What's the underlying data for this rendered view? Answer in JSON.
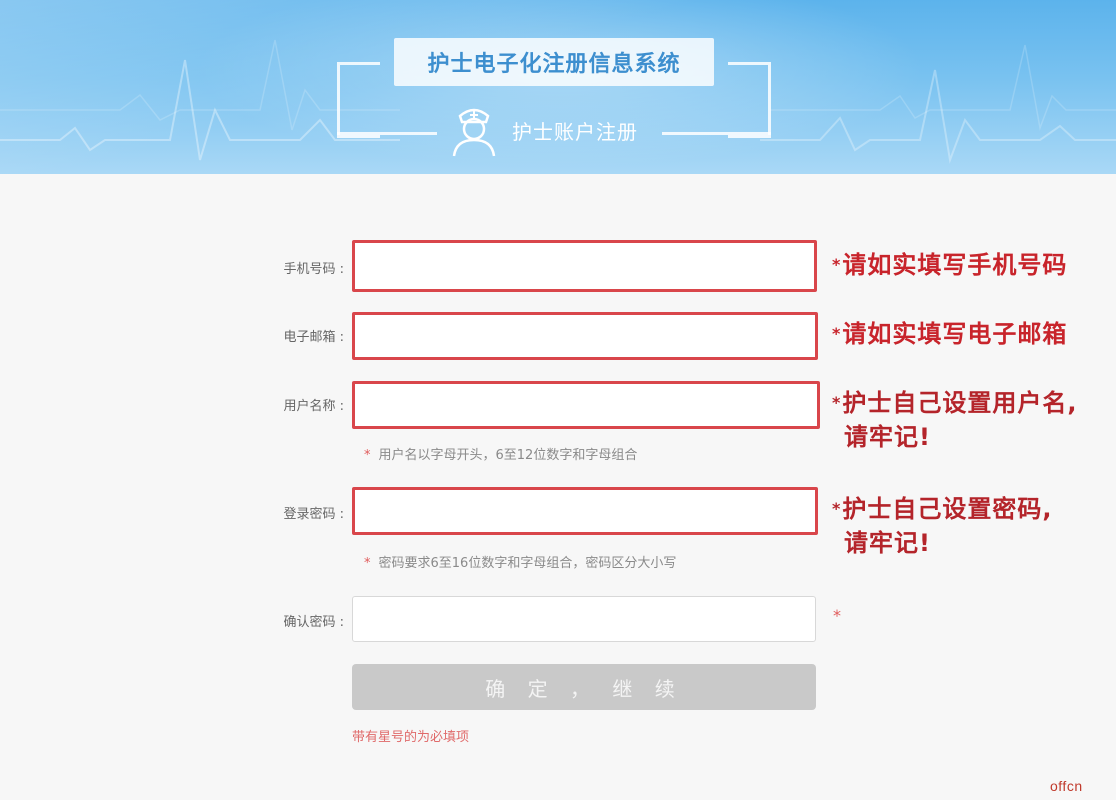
{
  "header": {
    "title": "护士电子化注册信息系统",
    "subtitle": "护士账户注册"
  },
  "form": {
    "fields": [
      {
        "label": "手机号码 :",
        "value": "",
        "annotation": "请如实填写手机号码"
      },
      {
        "label": "电子邮箱 :",
        "value": "",
        "annotation": "请如实填写电子邮箱"
      },
      {
        "label": "用户名称 :",
        "value": "",
        "annotation_line1": "护士自己设置用户名,",
        "annotation_line2": "请牢记!",
        "hint": "用户名以字母开头，6至12位数字和字母组合"
      },
      {
        "label": "登录密码 :",
        "value": "",
        "annotation_line1": "护士自己设置密码,",
        "annotation_line2": "请牢记!",
        "hint": "密码要求6至16位数字和字母组合，密码区分大小写"
      },
      {
        "label": "确认密码 :",
        "value": ""
      }
    ],
    "star": "*",
    "submit_label": "确 定 ， 继 续",
    "required_note": "带有星号的为必填项"
  },
  "watermark": "offcn",
  "colors": {
    "header_blue": "#5cb3ec",
    "title_blue": "#3d8fcf",
    "highlight_red": "#d9464b",
    "annotation_red": "#c8242b",
    "button_gray": "#c9c9c9"
  }
}
